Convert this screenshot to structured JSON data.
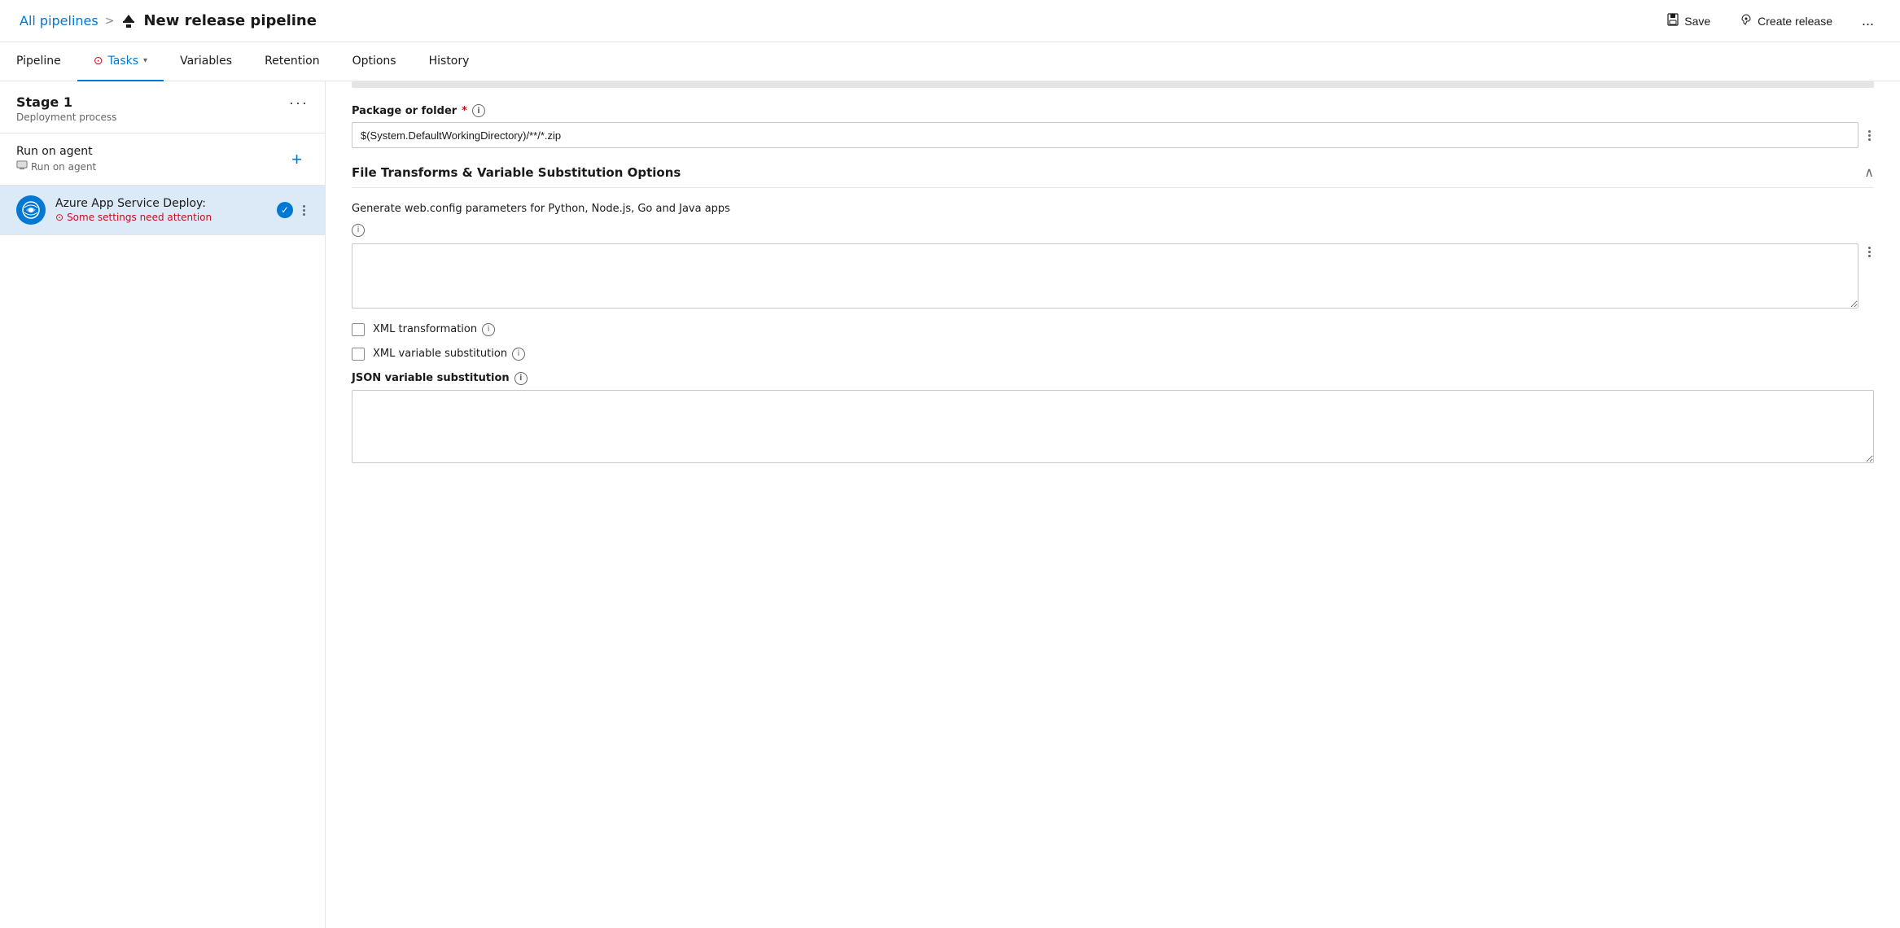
{
  "header": {
    "breadcrumb_link": "All pipelines",
    "breadcrumb_sep": ">",
    "pipeline_title": "New release pipeline",
    "save_label": "Save",
    "create_release_label": "Create release",
    "more_label": "..."
  },
  "nav": {
    "tabs": [
      {
        "id": "pipeline",
        "label": "Pipeline",
        "active": false,
        "warning": false,
        "dropdown": false
      },
      {
        "id": "tasks",
        "label": "Tasks",
        "active": true,
        "warning": true,
        "dropdown": true
      },
      {
        "id": "variables",
        "label": "Variables",
        "active": false,
        "warning": false,
        "dropdown": false
      },
      {
        "id": "retention",
        "label": "Retention",
        "active": false,
        "warning": false,
        "dropdown": false
      },
      {
        "id": "options",
        "label": "Options",
        "active": false,
        "warning": false,
        "dropdown": false
      },
      {
        "id": "history",
        "label": "History",
        "active": false,
        "warning": false,
        "dropdown": false
      }
    ]
  },
  "left_panel": {
    "stage_title": "Stage 1",
    "stage_subtitle": "Deployment process",
    "run_on_agent_title": "Run on agent",
    "run_on_agent_sub": "Run on agent",
    "task_name": "Azure App Service Deploy:",
    "task_warning": "Some settings need attention",
    "three_dots": "···"
  },
  "right_panel": {
    "package_label": "Package or folder",
    "package_required": "*",
    "package_value": "$(System.DefaultWorkingDirectory)/**/*.zip",
    "section_title": "File Transforms & Variable Substitution Options",
    "generate_webconfig_label": "Generate web.config parameters for Python, Node.js, Go and Java apps",
    "generate_webconfig_value": "",
    "xml_transformation_label": "XML transformation",
    "xml_variable_label": "XML variable substitution",
    "json_variable_label": "JSON variable substitution",
    "json_variable_value": "",
    "info_symbol": "i",
    "collapse_symbol": "∧"
  }
}
